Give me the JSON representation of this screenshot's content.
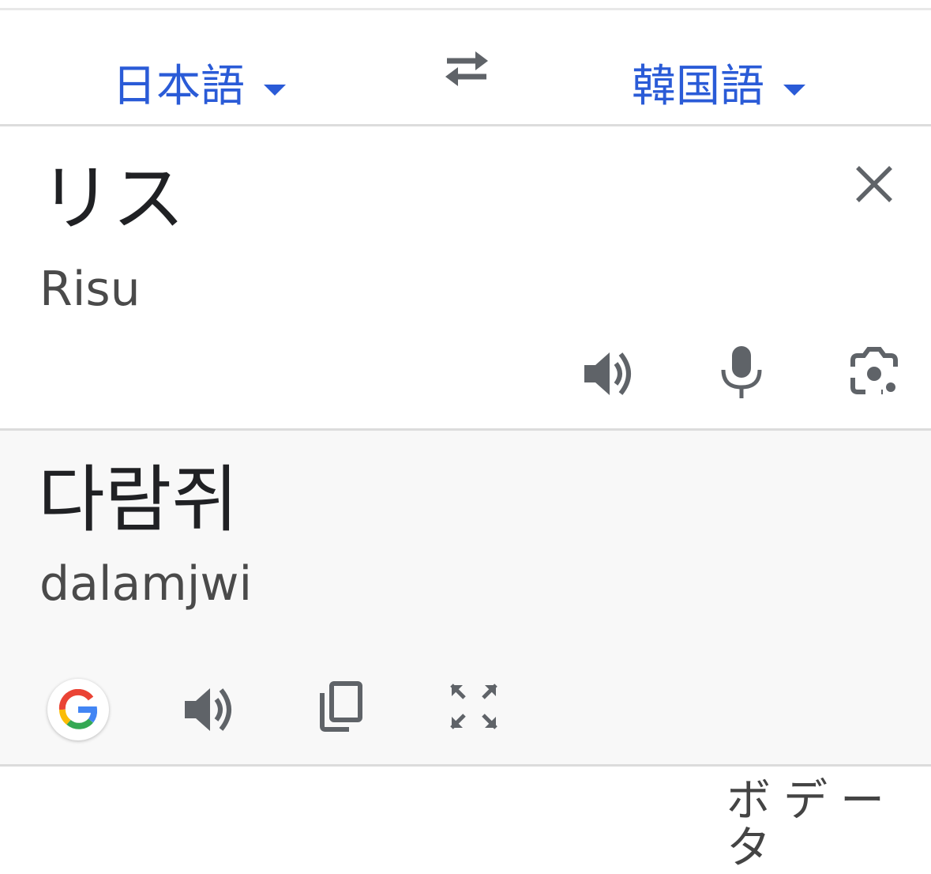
{
  "language_bar": {
    "source_language": "日本語",
    "target_language": "韓国語"
  },
  "source": {
    "text": "リス",
    "transliteration": "Risu"
  },
  "result": {
    "text": "다람쥐",
    "transliteration": "dalamjwi"
  },
  "footer": {
    "partial_text": "ボデータ"
  },
  "icons": {
    "swap": "swap-arrows-icon",
    "clear": "close-icon",
    "speak": "speaker-icon",
    "mic": "microphone-icon",
    "camera": "camera-icon",
    "google": "google-g-icon",
    "copy": "copy-icon",
    "fullscreen": "fullscreen-icon"
  },
  "colors": {
    "accent": "#2a5bd7",
    "icon": "#5f6368",
    "result_bg": "#f8f8f8"
  }
}
